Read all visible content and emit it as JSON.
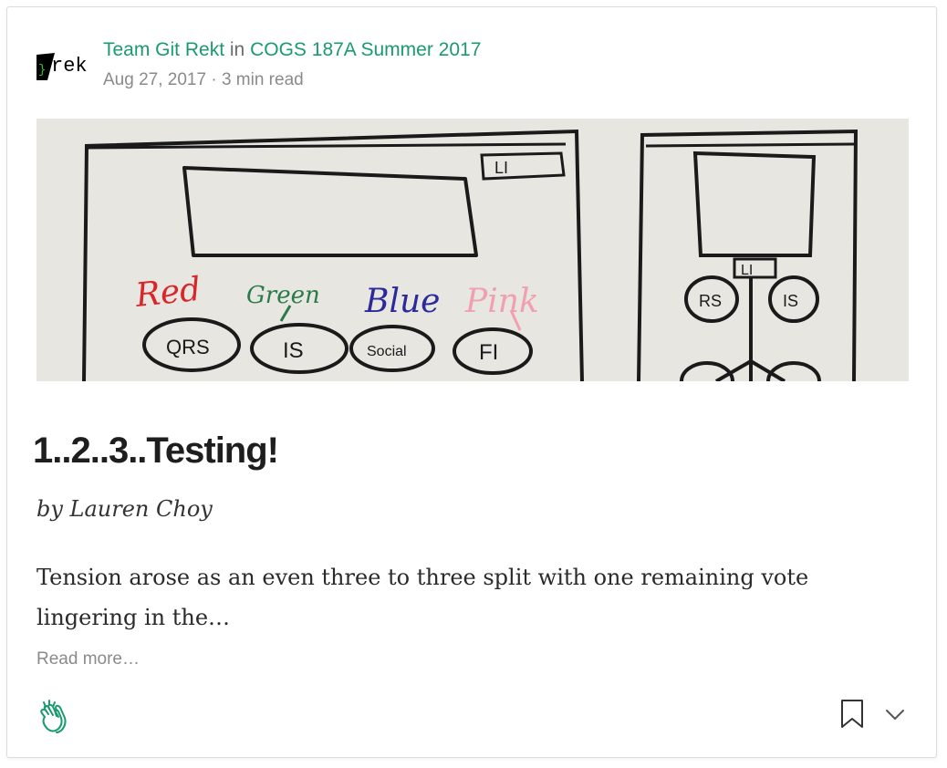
{
  "post": {
    "author": "Team Git Rekt",
    "connector": "in",
    "publication": "COGS 187A Summer 2017",
    "date": "Aug 27, 2017",
    "separator": "·",
    "read_time": "3 min read",
    "title": "1..2..3..Testing!",
    "byline": "by Lauren Choy",
    "excerpt": "Tension arose as an even three to three split with one remaining vote lingering in the…",
    "read_more": "Read more…"
  },
  "avatar": {
    "logo_text": "rek"
  },
  "hero_sketch": {
    "labels": [
      "Red",
      "Green",
      "Blue",
      "Pink"
    ],
    "buttons": [
      "QRS",
      "IS",
      "Social",
      "FI",
      "RS",
      "IS",
      "LI"
    ],
    "colors": {
      "red": "#d8262b",
      "green": "#2a7a4a",
      "blue": "#2a2a9a",
      "pink": "#f0a0b0",
      "ink": "#1a1a1a"
    }
  },
  "colors": {
    "accent": "#1a9a6f",
    "muted": "#8a8a8a"
  },
  "icons": {
    "clap": "clap-icon",
    "bookmark": "bookmark-icon",
    "more": "chevron-down-icon"
  }
}
